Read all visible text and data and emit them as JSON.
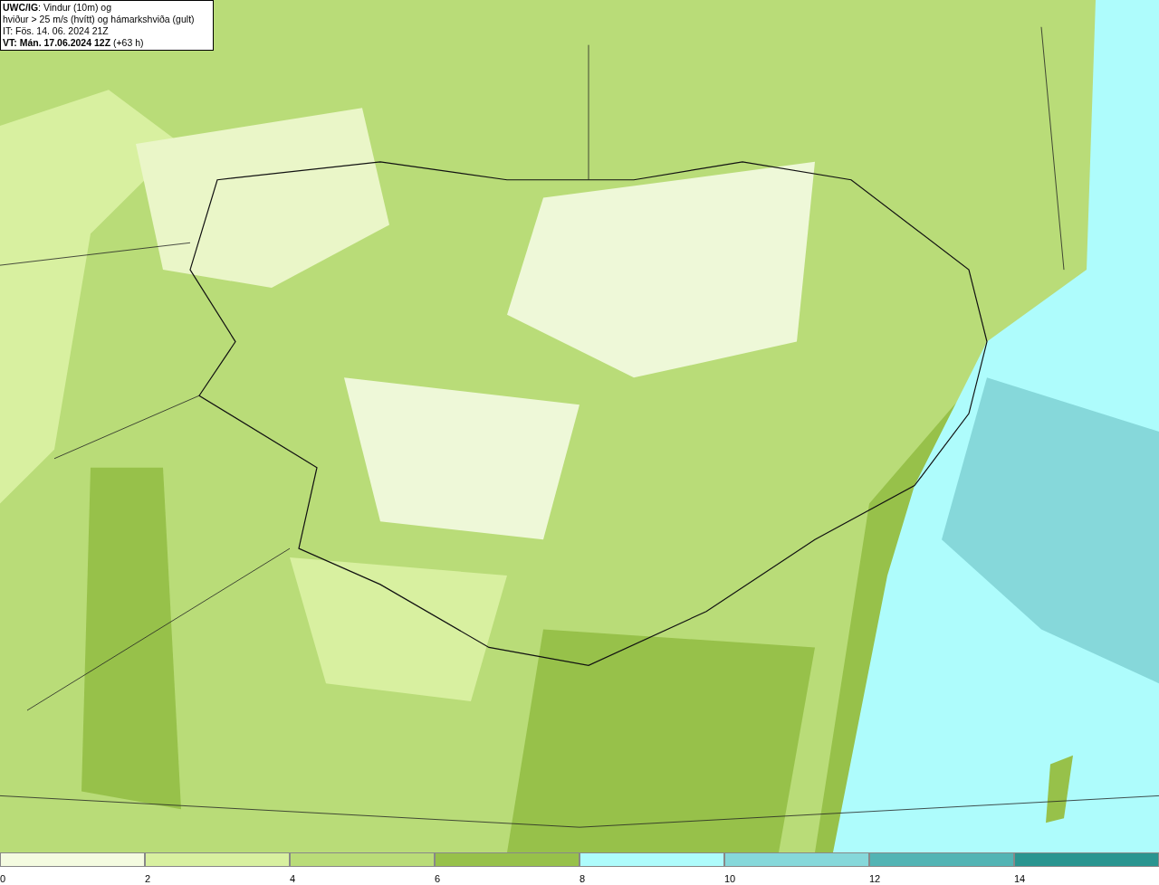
{
  "title_box": {
    "lines": [
      "**UWC/IG**: Vindur (10m) og",
      "hviður > 25 m/s (hvítt) og hámarkshviða (gult)",
      "IT: Fös. 14. 06. 2024 21Z",
      "**VT: Mán. 17.06.2024 12Z** (+63 h)"
    ]
  },
  "legend": {
    "bins": [
      {
        "label": "0",
        "color": "#f4fbe0"
      },
      {
        "label": "2",
        "color": "#d8f0a0"
      },
      {
        "label": "4",
        "color": "#b9dc78"
      },
      {
        "label": "6",
        "color": "#97c14a"
      },
      {
        "label": "8",
        "color": "#aefcfc"
      },
      {
        "label": "10",
        "color": "#86d8da"
      },
      {
        "label": "12",
        "color": "#52b4b4"
      },
      {
        "label": "14",
        "color": "#2a9590"
      }
    ]
  }
}
